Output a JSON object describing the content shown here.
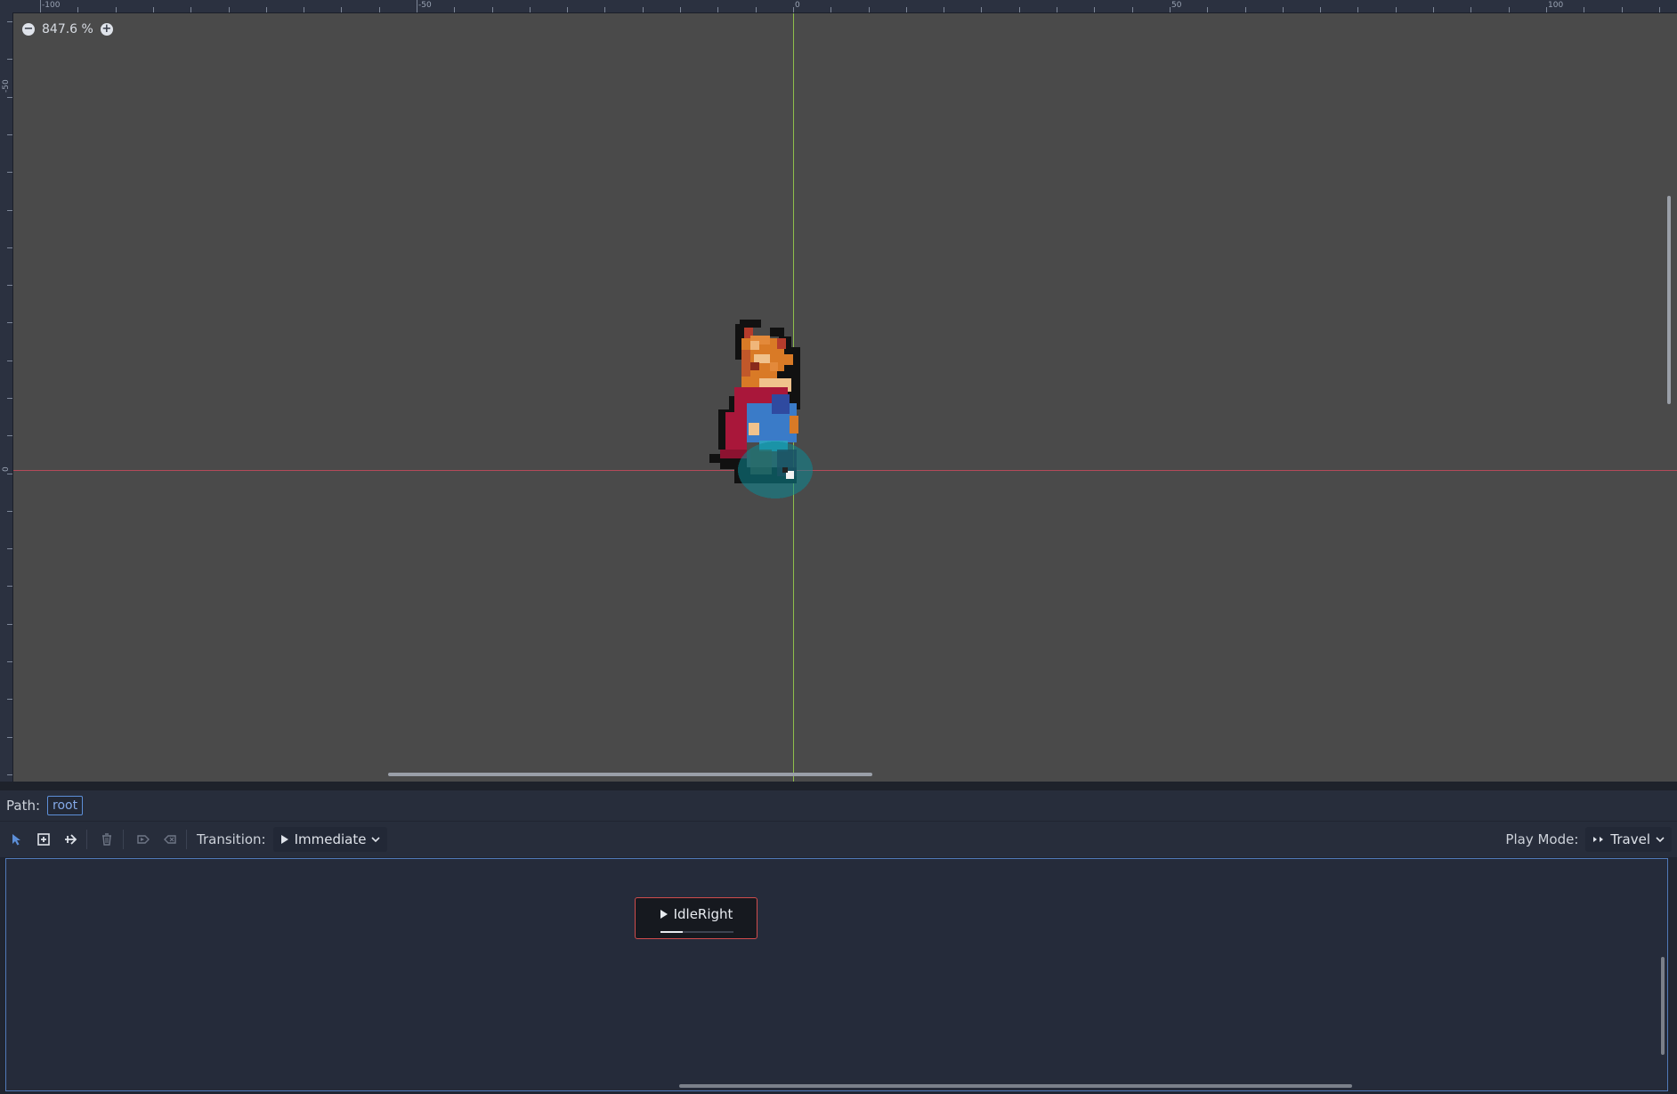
{
  "viewport": {
    "zoom_label": "847.6 %",
    "zoom_out_symbol": "−",
    "zoom_in_symbol": "+",
    "ruler_top_labels": [
      "-100",
      "-50",
      "0",
      "50",
      "100"
    ],
    "ruler_left_labels": [
      "-50",
      "0"
    ]
  },
  "path_bar": {
    "label": "Path:",
    "root_button": "root"
  },
  "toolbar": {
    "transition_label": "Transition:",
    "transition_value": "Immediate",
    "play_mode_label": "Play Mode:",
    "play_mode_value": "Travel"
  },
  "graph": {
    "nodes": [
      {
        "name": "IdleRight",
        "progress": 0.3
      }
    ]
  },
  "colors": {
    "accent": "#5d8fd8",
    "node_border": "#d04c4c",
    "axis_x": "#b44a5a",
    "axis_y": "#8fbf4b"
  }
}
